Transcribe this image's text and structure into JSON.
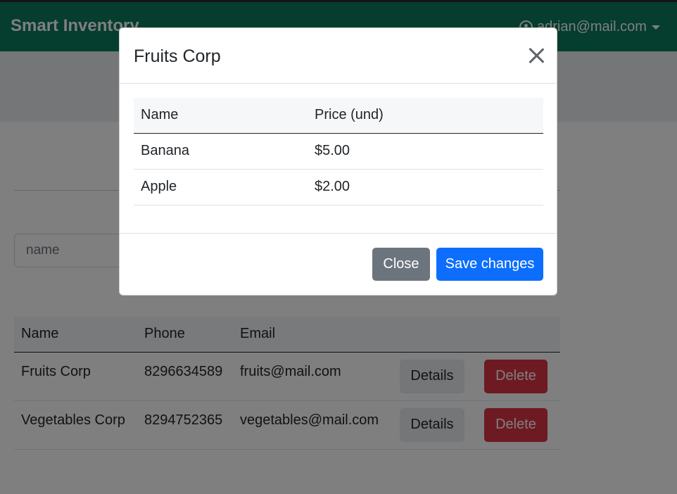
{
  "navbar": {
    "brand": "Smart Inventory",
    "user_email": "adrian@mail.com"
  },
  "search": {
    "placeholder": "name"
  },
  "suppliers_table": {
    "headers": [
      "Name",
      "Phone",
      "Email"
    ],
    "rows": [
      {
        "name": "Fruits Corp",
        "phone": "8296634589",
        "email": "fruits@mail.com",
        "details_label": "Details",
        "delete_label": "Delete"
      },
      {
        "name": "Vegetables Corp",
        "phone": "8294752365",
        "email": "vegetables@mail.com",
        "details_label": "Details",
        "delete_label": "Delete"
      }
    ]
  },
  "modal": {
    "title": "Fruits Corp",
    "table": {
      "headers": [
        "Name",
        "Price (und)"
      ],
      "rows": [
        {
          "name": "Banana",
          "price": "$5.00"
        },
        {
          "name": "Apple",
          "price": "$2.00"
        }
      ]
    },
    "close_label": "Close",
    "save_label": "Save changes"
  },
  "colors": {
    "navbar": "#0b7a5e",
    "primary": "#0d6efd",
    "secondary": "#6c757d",
    "danger": "#dc3545"
  }
}
